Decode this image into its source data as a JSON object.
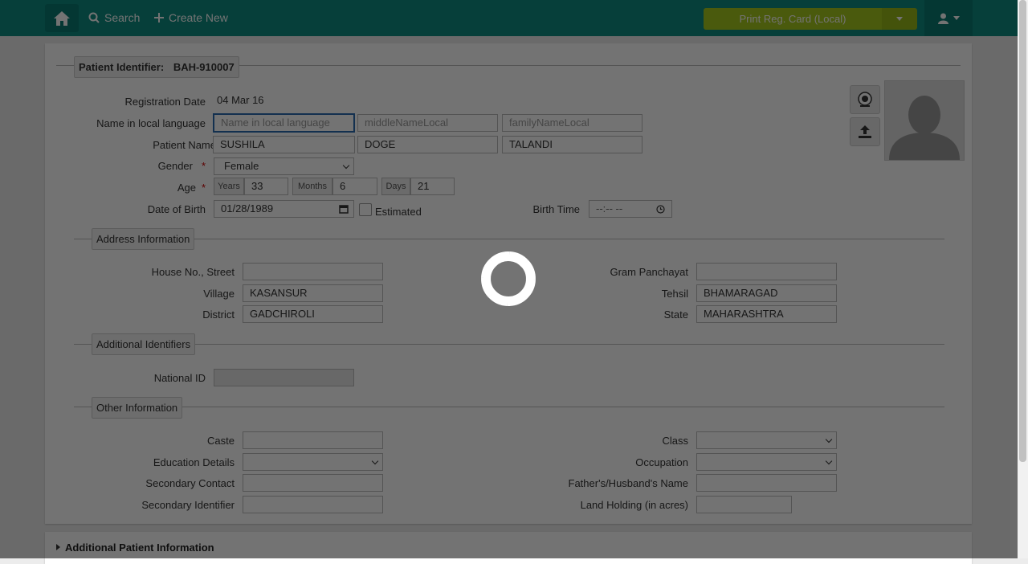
{
  "topbar": {
    "search_label": "Search",
    "create_label": "Create New",
    "print_label": "Print Reg. Card (Local)",
    "icons": {
      "home": "home-icon",
      "search": "search-icon",
      "plus": "plus-icon",
      "user": "user-icon",
      "caret": "caret-down-icon"
    },
    "color": "#0f8c82"
  },
  "patient": {
    "identifier_label": "Patient Identifier:",
    "identifier_value": "BAH-910007",
    "registration_date_label": "Registration Date",
    "registration_date": "04 Mar 16",
    "local_name_label": "Name in local language",
    "local_first_placeholder": "Name in local language",
    "local_middle_placeholder": "middleNameLocal",
    "local_family_placeholder": "familyNameLocal",
    "name_label": "Patient Name",
    "first_name": "SUSHILA",
    "middle_name": "DOGE",
    "family_name": "TALANDI",
    "gender_label": "Gender",
    "gender": "Female",
    "age_label": "Age",
    "years_label": "Years",
    "years": "33",
    "months_label": "Months",
    "months": "6",
    "days_label": "Days",
    "days": "21",
    "dob_label": "Date of Birth",
    "dob": "01/28/1989",
    "estimated_label": "Estimated",
    "birth_time_label": "Birth Time",
    "birth_time": "--:-- --",
    "required_mark": "*"
  },
  "address": {
    "legend": "Address Information",
    "house_label": "House No., Street",
    "house": "",
    "village_label": "Village",
    "village": "KASANSUR",
    "district_label": "District",
    "district": "GADCHIROLI",
    "gram_label": "Gram Panchayat",
    "gram": "",
    "tehsil_label": "Tehsil",
    "tehsil": "BHAMARAGAD",
    "state_label": "State",
    "state": "MAHARASHTRA"
  },
  "identifiers": {
    "legend": "Additional Identifiers",
    "national_id_label": "National ID",
    "national_id": ""
  },
  "other": {
    "legend": "Other Information",
    "caste_label": "Caste",
    "caste": "",
    "education_label": "Education Details",
    "education": "",
    "secondary_contact_label": "Secondary Contact",
    "secondary_contact": "",
    "secondary_identifier_label": "Secondary Identifier",
    "secondary_identifier": "",
    "class_label": "Class",
    "class": "",
    "occupation_label": "Occupation",
    "occupation": "",
    "father_label": "Father's/Husband's Name",
    "father": "",
    "land_label": "Land Holding (in acres)",
    "land": ""
  },
  "additional_info": {
    "label": "Additional Patient Information"
  }
}
